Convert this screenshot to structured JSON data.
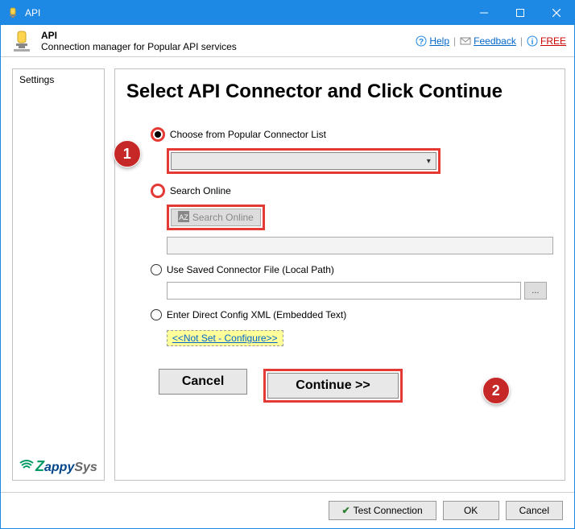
{
  "titlebar": {
    "title": "API"
  },
  "header": {
    "title": "API",
    "subtitle": "Connection manager for Popular API services",
    "links": {
      "help": "Help",
      "feedback": "Feedback",
      "free": "FREE"
    }
  },
  "sidebar": {
    "settings": "Settings",
    "brand": {
      "z": "Z",
      "appy": "appy",
      "sys": "Sys"
    }
  },
  "panel": {
    "title": "Select API Connector and Click Continue",
    "opt_popular": "Choose from Popular Connector List",
    "opt_search": "Search Online",
    "search_btn": "Search Online",
    "opt_local": "Use Saved Connector File (Local Path)",
    "browse": "...",
    "opt_xml": "Enter Direct Config XML (Embedded Text)",
    "xml_link": "<<Not Set - Configure>>",
    "cancel": "Cancel",
    "continue": "Continue >>"
  },
  "footer": {
    "test": "Test Connection",
    "ok": "OK",
    "cancel": "Cancel"
  },
  "badges": {
    "b1": "1",
    "b2": "2"
  }
}
